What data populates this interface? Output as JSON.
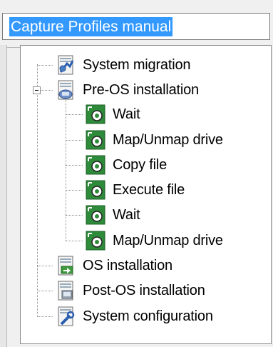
{
  "name_field": {
    "value": "Capture Profiles manual"
  },
  "tree": {
    "items": [
      {
        "label": "System migration",
        "icon": "system-migration-icon"
      },
      {
        "label": "Pre-OS installation",
        "icon": "pre-os-installation-icon",
        "expanded": true
      },
      {
        "label": "Wait",
        "icon": "gear-task-icon"
      },
      {
        "label": "Map/Unmap drive",
        "icon": "gear-task-icon"
      },
      {
        "label": "Copy file",
        "icon": "gear-task-icon"
      },
      {
        "label": "Execute file",
        "icon": "gear-task-icon"
      },
      {
        "label": "Wait",
        "icon": "gear-task-icon"
      },
      {
        "label": "Map/Unmap drive",
        "icon": "gear-task-icon"
      },
      {
        "label": "OS installation",
        "icon": "os-installation-icon"
      },
      {
        "label": "Post-OS installation",
        "icon": "post-os-installation-icon"
      },
      {
        "label": "System configuration",
        "icon": "system-configuration-icon"
      }
    ]
  },
  "colors": {
    "selection": "#3399ff",
    "task_icon_green": "#2e8b3a",
    "doc_blue": "#2a5fb0"
  }
}
